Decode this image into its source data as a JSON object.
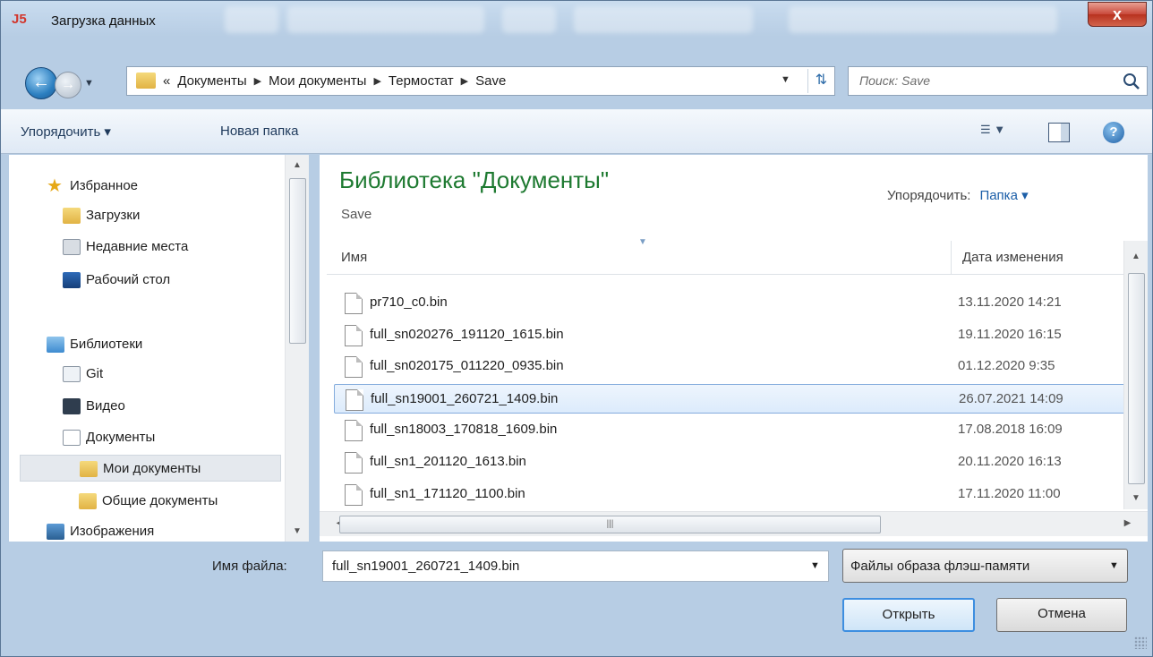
{
  "window": {
    "title": "Загрузка данных",
    "app_icon_text": "J5",
    "close_label": "x"
  },
  "address": {
    "prefix": "«",
    "crumbs": [
      "Документы",
      "Мои документы",
      "Термостат",
      "Save"
    ]
  },
  "search": {
    "placeholder": "Поиск: Save"
  },
  "toolbar": {
    "organize": "Упорядочить ▾",
    "new_folder": "Новая папка"
  },
  "nav": {
    "favorites": "Избранное",
    "downloads": "Загрузки",
    "recent": "Недавние места",
    "desktop": "Рабочий стол",
    "libraries": "Библиотеки",
    "git": "Git",
    "video": "Видео",
    "documents": "Документы",
    "my_documents": "Мои документы",
    "shared_documents": "Общие документы",
    "images": "Изображения"
  },
  "library": {
    "title": "Библиотека \"Документы\"",
    "subtitle": "Save",
    "arrange_label": "Упорядочить:",
    "arrange_value": "Папка ▾"
  },
  "columns": {
    "name": "Имя",
    "date": "Дата изменения"
  },
  "files": [
    {
      "name": "pr710_c0.bin",
      "date": "13.11.2020 14:21"
    },
    {
      "name": "full_sn020276_191120_1615.bin",
      "date": "19.11.2020 16:15"
    },
    {
      "name": "full_sn020175_011220_0935.bin",
      "date": "01.12.2020 9:35"
    },
    {
      "name": "full_sn19001_260721_1409.bin",
      "date": "26.07.2021 14:09"
    },
    {
      "name": "full_sn18003_170818_1609.bin",
      "date": "17.08.2018 16:09"
    },
    {
      "name": "full_sn1_201120_1613.bin",
      "date": "20.11.2020 16:13"
    },
    {
      "name": "full_sn1_171120_1100.bin",
      "date": "17.11.2020 11:00"
    }
  ],
  "bottom": {
    "filename_label": "Имя файла:",
    "filename_value": "full_sn19001_260721_1409.bin",
    "filter_value": "Файлы образа флэш-памяти",
    "open_label": "Открыть",
    "cancel_label": "Отмена"
  }
}
